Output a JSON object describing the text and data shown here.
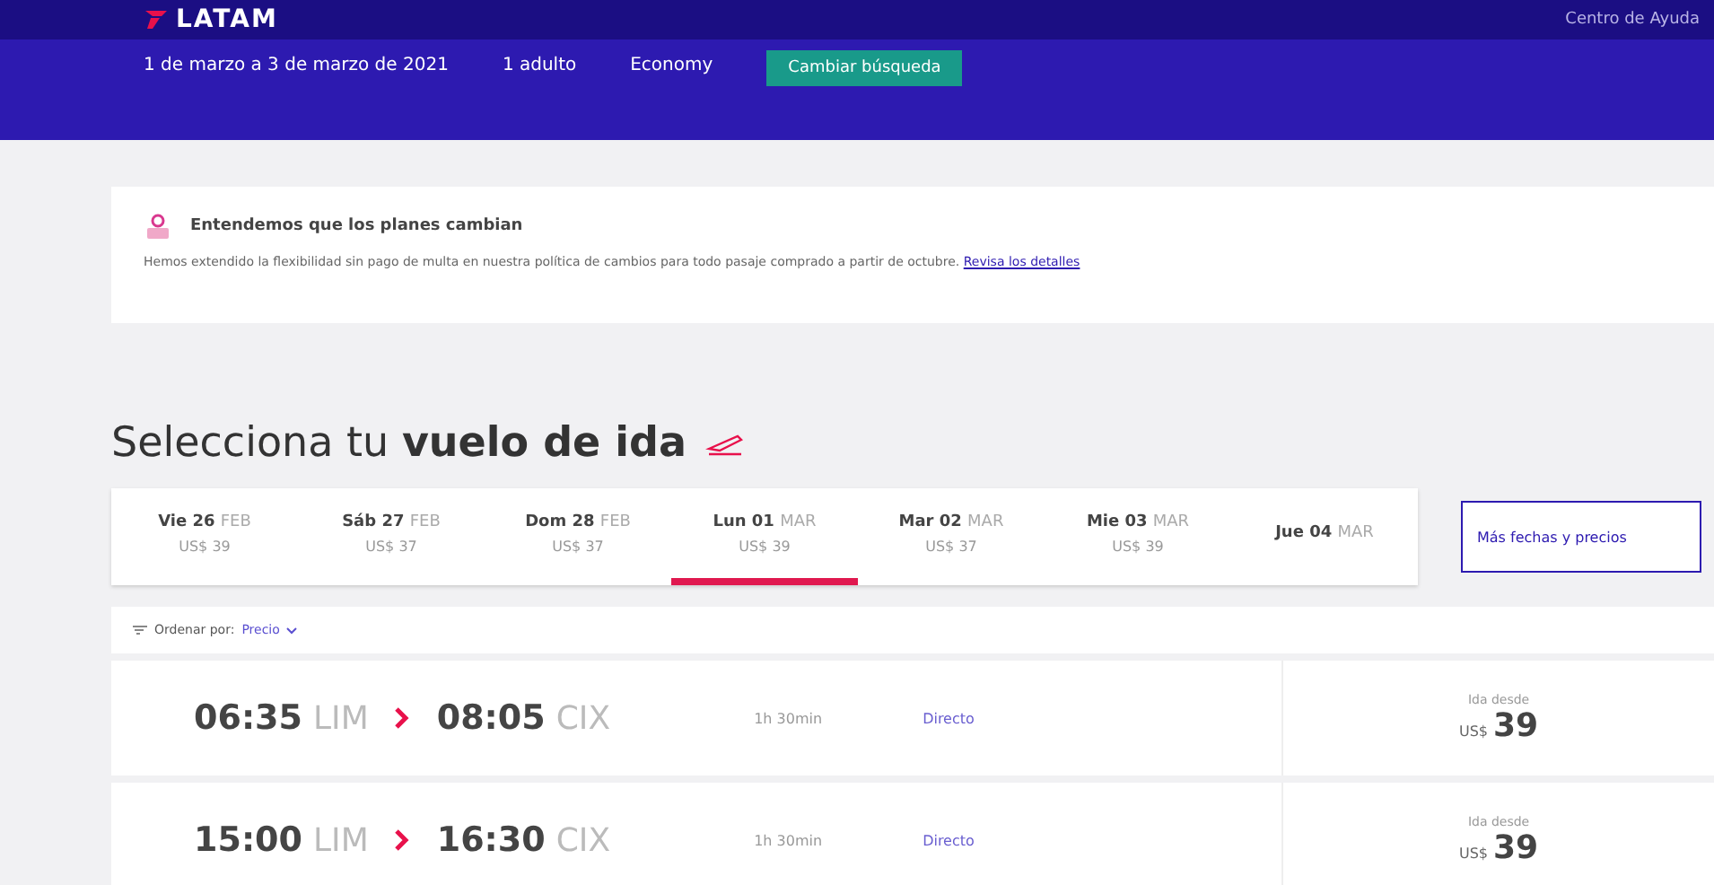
{
  "header": {
    "logo": "LATAM",
    "help_link": "Centro de Ayuda",
    "dates": "1 de marzo a 3 de marzo de 2021",
    "passengers": "1 adulto",
    "cabin": "Economy",
    "change_button": "Cambiar búsqueda"
  },
  "notice": {
    "title": "Entendemos que los planes cambian",
    "text": "Hemos extendido la flexibilidad sin pago de multa en nuestra política de cambios para todo pasaje comprado a partir de octubre.",
    "link": "Revisa los detalles"
  },
  "heading": "Selecciona tu **vuelo de ida**",
  "date_tabs": [
    {
      "day": "Vie 26",
      "month": "FEB",
      "price": "US$ 39",
      "selected": false
    },
    {
      "day": "Sáb 27",
      "month": "FEB",
      "price": "US$ 37",
      "selected": false
    },
    {
      "day": "Dom 28",
      "month": "FEB",
      "price": "US$ 37",
      "selected": false
    },
    {
      "day": "Lun 01",
      "month": "MAR",
      "price": "US$ 39",
      "selected": true
    },
    {
      "day": "Mar 02",
      "month": "MAR",
      "price": "US$ 37",
      "selected": false
    },
    {
      "day": "Mie 03",
      "month": "MAR",
      "price": "US$ 39",
      "selected": false
    },
    {
      "day": "Jue 04",
      "month": "MAR",
      "selected": false
    }
  ],
  "more_dates_button": "Más fechas y precios",
  "sort": {
    "label": "Ordenar por:",
    "value": "Precio"
  },
  "flights": [
    {
      "depart_time": "06:35",
      "origin": "LIM",
      "arrive_time": "08:05",
      "destination": "CIX",
      "duration": "1h 30min",
      "stops": "Directo",
      "price_label": "Ida desde",
      "currency": "US$",
      "price": "39"
    },
    {
      "depart_time": "15:00",
      "origin": "LIM",
      "arrive_time": "16:30",
      "destination": "CIX",
      "duration": "1h 30min",
      "stops": "Directo",
      "price_label": "Ida desde",
      "currency": "US$",
      "price": "39"
    }
  ]
}
